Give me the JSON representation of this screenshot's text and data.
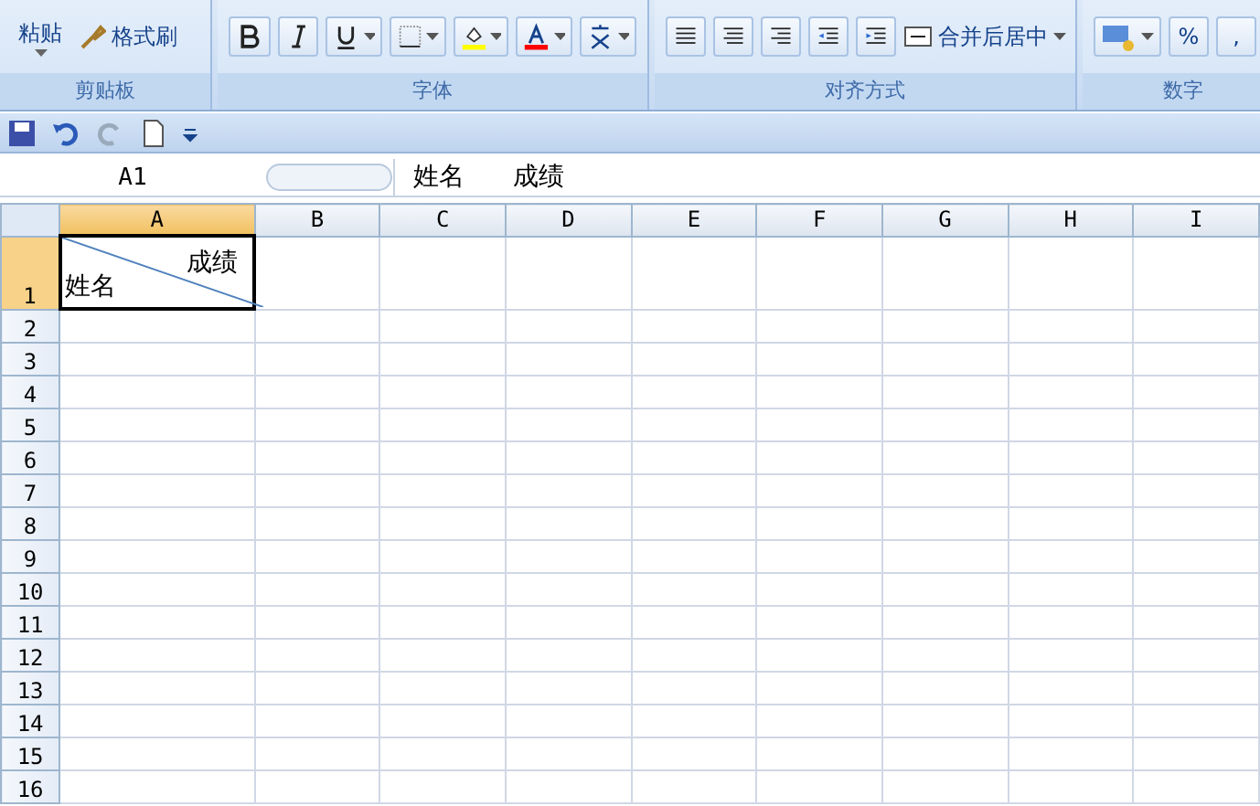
{
  "ribbon": {
    "groups": [
      {
        "label": "剪贴板",
        "items": [
          {
            "kind": "paste",
            "label": "粘贴"
          },
          {
            "kind": "painter",
            "label": "格式刷"
          }
        ]
      },
      {
        "label": "字体",
        "items": [
          {
            "kind": "bold"
          },
          {
            "kind": "italic"
          },
          {
            "kind": "underline"
          },
          {
            "kind": "border"
          },
          {
            "kind": "fill"
          },
          {
            "kind": "fontcolor"
          },
          {
            "kind": "phonetic"
          }
        ]
      },
      {
        "label": "对齐方式",
        "items": [
          {
            "kind": "left"
          },
          {
            "kind": "center"
          },
          {
            "kind": "right"
          },
          {
            "kind": "outdent"
          },
          {
            "kind": "indent"
          },
          {
            "kind": "merge",
            "label": "合并后居中"
          }
        ]
      },
      {
        "label": "数字",
        "items": [
          {
            "kind": "accounting"
          },
          {
            "kind": "percent",
            "label": "%"
          },
          {
            "kind": "comma",
            "label": ","
          }
        ]
      }
    ]
  },
  "name_box": {
    "value": "A1"
  },
  "formula_bar": {
    "value": "姓名      成绩"
  },
  "columns": [
    {
      "label": "A",
      "selected": true
    },
    {
      "label": "B",
      "selected": false
    },
    {
      "label": "C",
      "selected": false
    },
    {
      "label": "D",
      "selected": false
    },
    {
      "label": "E",
      "selected": false
    },
    {
      "label": "F",
      "selected": false
    },
    {
      "label": "G",
      "selected": false
    },
    {
      "label": "H",
      "selected": false
    },
    {
      "label": "I",
      "selected": false
    }
  ],
  "rows": [
    {
      "label": "1",
      "selected": true
    },
    {
      "label": "2",
      "selected": false
    },
    {
      "label": "3",
      "selected": false
    },
    {
      "label": "4",
      "selected": false
    },
    {
      "label": "5",
      "selected": false
    },
    {
      "label": "6",
      "selected": false
    },
    {
      "label": "7",
      "selected": false
    },
    {
      "label": "8",
      "selected": false
    },
    {
      "label": "9",
      "selected": false
    },
    {
      "label": "10",
      "selected": false
    },
    {
      "label": "11",
      "selected": false
    },
    {
      "label": "12",
      "selected": false
    },
    {
      "label": "13",
      "selected": false
    },
    {
      "label": "14",
      "selected": false
    },
    {
      "label": "15",
      "selected": false
    },
    {
      "label": "16",
      "selected": false
    }
  ],
  "active_cell": {
    "top_right": "成绩",
    "bottom_left": "姓名"
  }
}
